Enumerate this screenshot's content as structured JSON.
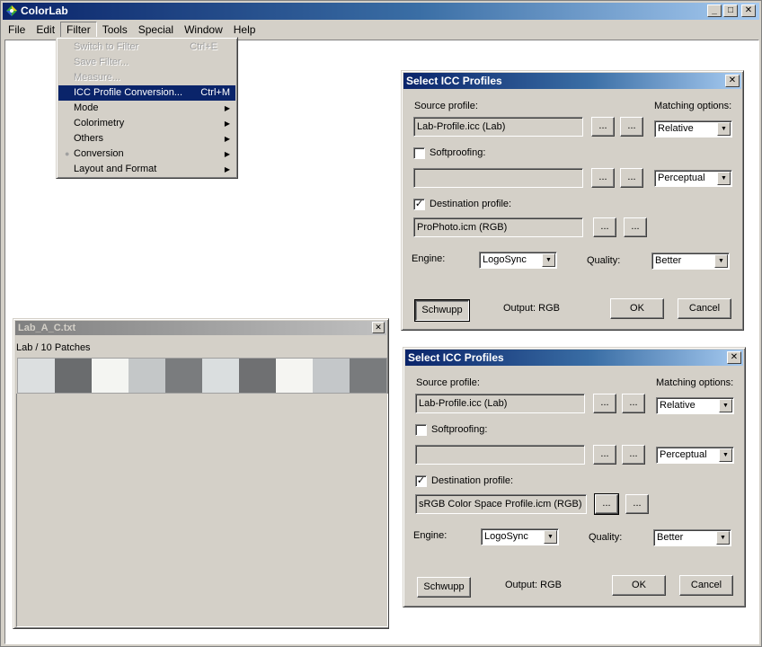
{
  "app": {
    "title": "ColorLab"
  },
  "window_buttons": {
    "minimize": "_",
    "maximize": "□",
    "close": "✕"
  },
  "menubar": [
    "File",
    "Edit",
    "Filter",
    "Tools",
    "Special",
    "Window",
    "Help"
  ],
  "filter_menu": {
    "items": [
      {
        "label": "Switch to Filter",
        "shortcut": "Ctrl+E",
        "disabled": true
      },
      {
        "label": "Save Filter...",
        "shortcut": "",
        "disabled": true
      },
      {
        "label": "Measure...",
        "shortcut": "",
        "disabled": true
      },
      {
        "label": "ICC Profile Conversion...",
        "shortcut": "Ctrl+M",
        "highlighted": true
      },
      {
        "label": "Mode",
        "submenu": true
      },
      {
        "label": "Colorimetry",
        "submenu": true
      },
      {
        "label": "Others",
        "submenu": true
      },
      {
        "label": "Conversion",
        "submenu": true,
        "radio": true
      },
      {
        "label": "Layout and Format",
        "submenu": true
      }
    ],
    "arrow": "▶",
    "radio_mark": "●"
  },
  "doc": {
    "title": "Lab_A_C.txt",
    "close": "✕",
    "subtitle": "Lab / 10 Patches",
    "patch_colors": [
      "#dcdfe0",
      "#6a6c6e",
      "#f4f5f2",
      "#c4c7c8",
      "#7a7c7e",
      "#dadedf",
      "#6f7072",
      "#f5f5f2",
      "#c4c7c9",
      "#797b7d"
    ]
  },
  "dialogs": [
    {
      "title": "Select ICC Profiles",
      "source_label": "Source profile:",
      "source_value": "Lab-Profile.icc (Lab)",
      "matching_label": "Matching options:",
      "matching_value": "Relative",
      "softproof_label": "Softproofing:",
      "softproof_checked": "",
      "softproof_value": "",
      "perceptual_value": "Perceptual",
      "dest_label": "Destination profile:",
      "dest_checked": "✓",
      "dest_value": "ProPhoto.icm (RGB)",
      "engine_label": "Engine:",
      "engine_value": "LogoSync",
      "quality_label": "Quality:",
      "quality_value": "Better",
      "schwupp": "Schwupp",
      "output": "Output: RGB",
      "ok": "OK",
      "cancel": "Cancel",
      "browse": "...",
      "close": "✕",
      "dd": "▼"
    },
    {
      "title": "Select ICC Profiles",
      "source_label": "Source profile:",
      "source_value": "Lab-Profile.icc (Lab)",
      "matching_label": "Matching options:",
      "matching_value": "Relative",
      "softproof_label": "Softproofing:",
      "softproof_checked": "",
      "softproof_value": "",
      "perceptual_value": "Perceptual",
      "dest_label": "Destination profile:",
      "dest_checked": "✓",
      "dest_value": "sRGB Color Space Profile.icm (RGB)",
      "engine_label": "Engine:",
      "engine_value": "LogoSync",
      "quality_label": "Quality:",
      "quality_value": "Better",
      "schwupp": "Schwupp",
      "output": "Output: RGB",
      "ok": "OK",
      "cancel": "Cancel",
      "browse": "...",
      "close": "✕",
      "dd": "▼"
    }
  ]
}
